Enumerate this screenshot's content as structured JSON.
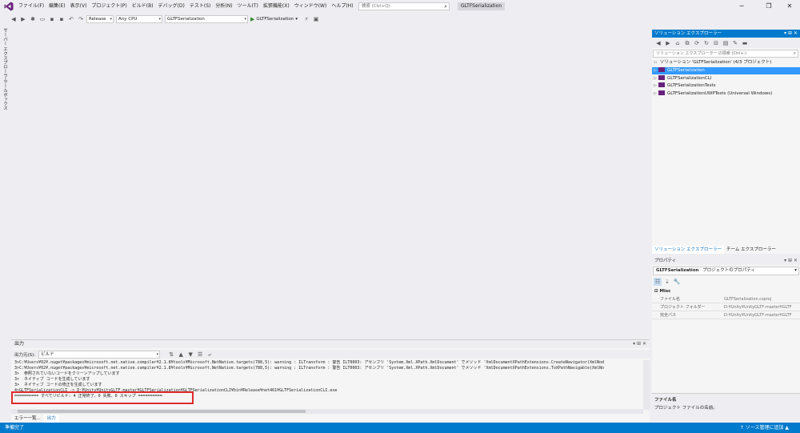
{
  "colors": {
    "accent": "#007acc",
    "selected": "#3399ff",
    "highlight": "#e02b2b",
    "vs_purple": "#68217a",
    "play_green": "#388a34"
  },
  "menu": {
    "items": [
      "ファイル(F)",
      "編集(E)",
      "表示(V)",
      "プロジェクト(P)",
      "ビルド(B)",
      "デバッグ(D)",
      "テスト(S)",
      "分析(N)",
      "ツール(T)",
      "拡張機能(X)",
      "ウィンドウ(W)",
      "ヘルプ(H)"
    ],
    "search_placeholder": "検索 (Ctrl+Q)",
    "search_icon": "search-icon",
    "title": "GLTFSerialization",
    "window_buttons": [
      "─",
      "❐",
      "✕"
    ]
  },
  "toolbar": {
    "configuration": "Release",
    "platform": "Any CPU",
    "startup_project": "GLTFSerialization",
    "start_label": "GLTFSerialization"
  },
  "left_strip": {
    "tabs": [
      "サーバー エクスプローラー",
      "ツールボックス"
    ]
  },
  "output": {
    "title": "出力",
    "source_label": "出力元(S):",
    "source_value": "ビルド",
    "lines": [
      "3>C:¥Users¥02¥.nuget¥packages¥microsoft.net.native.compiler¥2.1.8¥tools¥Microsoft.NetNative.targets(788,5): warning : ILTransform : 警告 ILT0003: アセンブリ 'System.Xml.XPath.XmlDocument' でメソッド 'XmlDocumentXPathExtensions.CreateNavigator(XmlNod",
      "3>C:¥Users¥02¥.nuget¥packages¥microsoft.net.native.compiler¥2.1.8¥tools¥Microsoft.NetNative.targets(788,5): warning : ILTransform : 警告 ILT0003: アセンブリ 'System.Xml.XPath.XmlDocument' でメソッド 'XmlDocumentXPathExtensions.ToXPathNavigable(XmlNo",
      "3>  参照されていないコードをクリーンアップしています",
      "3>  ネイティブ コードを生成しています",
      "3>  ネイティブ コードの修正を生成しています",
      "4>GLTFSerializationCLI -> D:¥Unity¥UnityGLTF-master¥GLTFSerialization¥GLTFSerializationCLI¥bin¥Release¥net461¥GLTFSerializationCLI.exe",
      "========== すべてリビルド: 4 正常終了、0 失敗、0 スキップ =========="
    ],
    "bottom_tabs": [
      "エラー一覧...",
      "出力"
    ]
  },
  "solution_explorer": {
    "title": "ソリューション エクスプローラー",
    "search_placeholder": "ソリューション エクスプローラー の検索 (Ctrl+:)",
    "solution_label": "ソリューション 'GLTFSerialization' (4/3 プロジェクト)",
    "projects": [
      "GLTFSerialization",
      "GLTFSerializationCLI",
      "GLTFSerializationTests",
      "GLTFSerializationUWPTests (Universal Windows)"
    ],
    "selected_index": 0,
    "tabs": [
      "ソリューション エクスプローラー",
      "チーム エクスプローラー"
    ]
  },
  "properties": {
    "title": "プロパティ",
    "object_name": "GLTFSerialization",
    "object_type": "プロジェクトのプロパティ",
    "category": "Misc",
    "rows": [
      {
        "name": "ファイル名",
        "value": "GLTFSerialization.csproj"
      },
      {
        "name": "プロジェクト フォルダー",
        "value": "D:¥Unity¥UnityGLTF-master¥GLTF"
      },
      {
        "name": "完全パス",
        "value": "D:¥Unity¥UnityGLTF-master¥GLTF"
      }
    ],
    "desc_title": "ファイル名",
    "desc_text": "プロジェクト ファイルの名前。"
  },
  "status": {
    "text": "準備完了",
    "scc": "↑ ソース管理に追加 ▲"
  }
}
